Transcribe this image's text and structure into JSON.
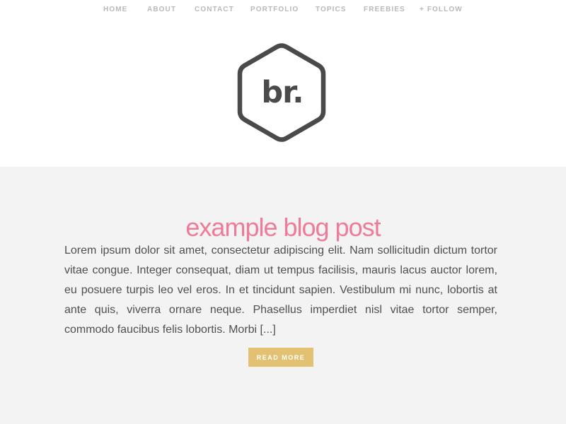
{
  "nav": {
    "items": [
      {
        "label": "HOME"
      },
      {
        "label": "ABOUT"
      },
      {
        "label": "CONTACT"
      },
      {
        "label": "PORTFOLIO"
      },
      {
        "label": "TOPICS"
      },
      {
        "label": "FREEBIES"
      },
      {
        "label": "+ FOLLOW"
      }
    ]
  },
  "logo": {
    "text": "br.",
    "icon": "hexagon-logo-icon"
  },
  "post": {
    "title": "example blog post",
    "excerpt": "Lorem ipsum dolor sit amet, consectetur adipiscing elit. Nam sollicitudin dictum tortor vitae congue. Integer consequat, diam ut tempus facilisis, mauris lacus auctor lorem, eu posuere turpis leo vel eros. In et tincidunt sapien. Vestibulum mi nunc, lobortis at ante quis, viverra ornare neque. Phasellus imperdiet nisl vitae tortor semper, commodo faucibus felis lobortis. Morbi [...]",
    "read_more_label": "READ MORE"
  },
  "colors": {
    "nav_text": "#b9b9b9",
    "logo": "#4a4a4a",
    "title": "#ee7c99",
    "body_text": "#4f4f4f",
    "content_bg": "#f3f3f3",
    "button": "#e2c172"
  }
}
